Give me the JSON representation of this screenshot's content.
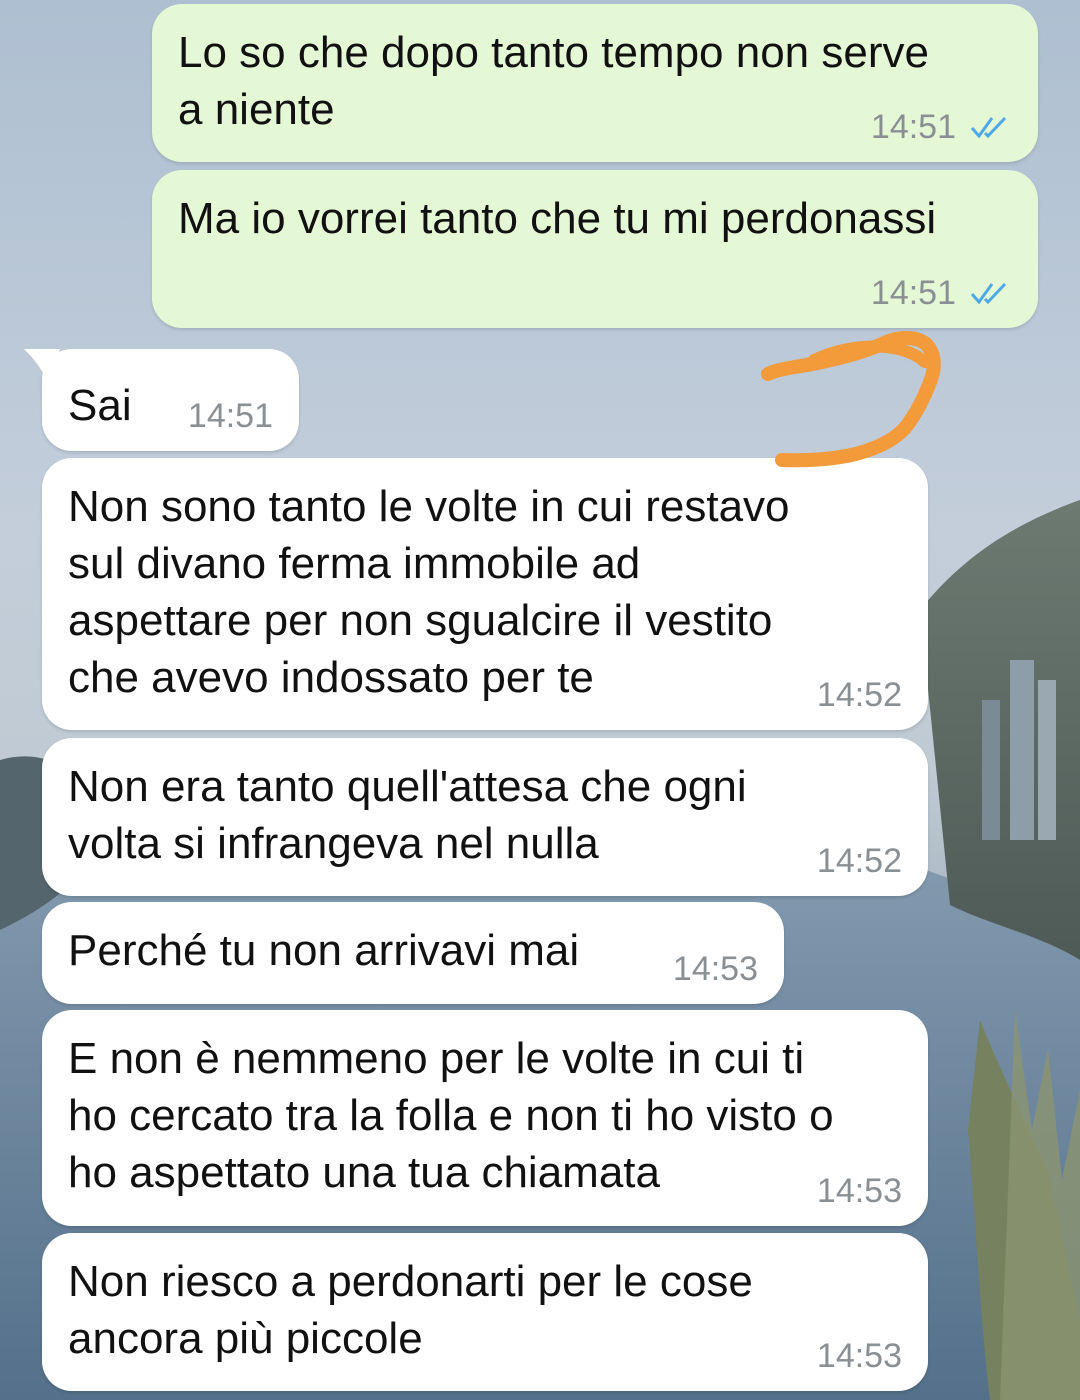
{
  "messages": [
    {
      "direction": "outgoing",
      "text": "Lo so che dopo tanto tempo non serve\na niente",
      "time": "14:51",
      "status_icon": "double-check-icon"
    },
    {
      "direction": "outgoing",
      "text": "Ma io vorrei tanto che tu mi perdonassi",
      "time": "14:51",
      "status_icon": "double-check-icon"
    },
    {
      "direction": "incoming",
      "text": "Sai",
      "time": "14:51"
    },
    {
      "direction": "incoming",
      "text": "Non sono tanto le volte in cui restavo\nsul divano ferma immobile ad\naspettare per non sgualcire il vestito\nche avevo indossato per te",
      "time": "14:52"
    },
    {
      "direction": "incoming",
      "text": "Non era tanto quell'attesa che ogni\nvolta si infrangeva nel nulla",
      "time": "14:52"
    },
    {
      "direction": "incoming",
      "text": "Perché tu non arrivavi mai",
      "time": "14:53"
    },
    {
      "direction": "incoming",
      "text": "E non è nemmeno per le volte in cui ti\nho cercato tra la folla e non ti ho visto o\nho aspettato una tua chiamata",
      "time": "14:53"
    },
    {
      "direction": "incoming",
      "text": "Non riesco a perdonarti per le cose\nancora più piccole",
      "time": "14:53"
    }
  ],
  "colors": {
    "outgoing_bubble": "#e5f8d6",
    "incoming_bubble": "#ffffff",
    "read_ticks": "#4fa9e6",
    "annotation": "#f39a3a",
    "timestamp": "#8a8f94"
  },
  "annotation": {
    "icon": "orange-scribble-annotation",
    "glyph": "9"
  }
}
